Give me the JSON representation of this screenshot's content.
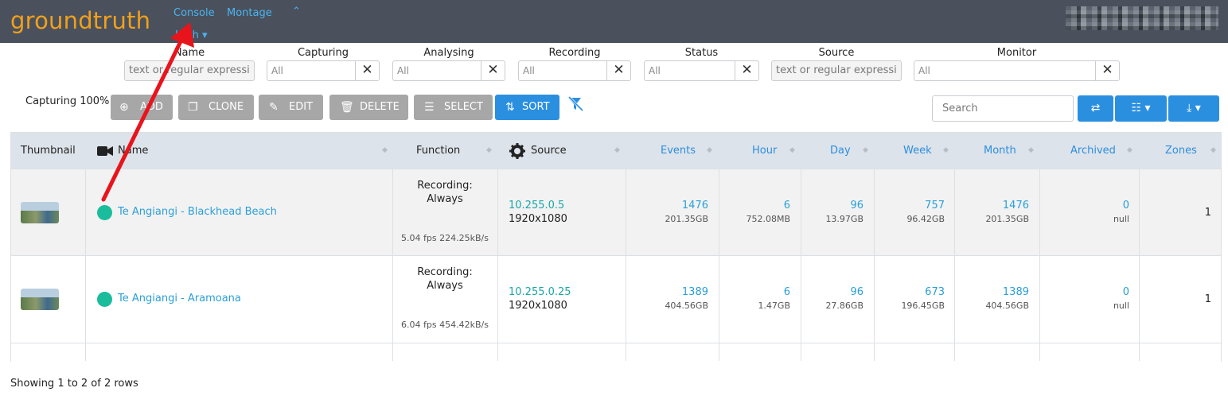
{
  "brand": "groundtruth",
  "nav": {
    "console": "Console",
    "montage": "Montage",
    "caret": "^",
    "bandwidth": "High ▾"
  },
  "filters": {
    "name": {
      "label": "Name",
      "placeholder": "text or regular expressi"
    },
    "capturing": {
      "label": "Capturing",
      "value": "All"
    },
    "analysing": {
      "label": "Analysing",
      "value": "All"
    },
    "recording": {
      "label": "Recording",
      "value": "All"
    },
    "status": {
      "label": "Status",
      "value": "All"
    },
    "source": {
      "label": "Source",
      "placeholder": "text or regular expressi"
    },
    "monitor": {
      "label": "Monitor",
      "value": "All"
    }
  },
  "capturing_pct": "Capturing 100%",
  "toolbar": {
    "add": "ADD",
    "clone": "CLONE",
    "edit": "EDIT",
    "delete": "DELETE",
    "select": "SELECT",
    "sort": "SORT"
  },
  "search_placeholder": "Search",
  "table": {
    "headers": {
      "thumbnail": "Thumbnail",
      "name": "Name",
      "function": "Function",
      "source": "Source",
      "events": "Events",
      "hour": "Hour",
      "day": "Day",
      "week": "Week",
      "month": "Month",
      "archived": "Archived",
      "zones": "Zones"
    },
    "rows": [
      {
        "name": "Te Angiangi - Blackhead Beach",
        "function_line1": "Recording:",
        "function_line2": "Always",
        "fps": "5.04 fps 224.25kB/s",
        "source_ip": "10.255.0.5",
        "source_res": "1920x1080",
        "events": "1476",
        "events_size": "201.35GB",
        "hour": "6",
        "hour_size": "752.08MB",
        "day": "96",
        "day_size": "13.97GB",
        "week": "757",
        "week_size": "96.42GB",
        "month": "1476",
        "month_size": "201.35GB",
        "archived": "0",
        "archived_size": "null",
        "zones": "1"
      },
      {
        "name": "Te Angiangi - Aramoana",
        "function_line1": "Recording:",
        "function_line2": "Always",
        "fps": "6.04 fps 454.42kB/s",
        "source_ip": "10.255.0.25",
        "source_res": "1920x1080",
        "events": "1389",
        "events_size": "404.56GB",
        "hour": "6",
        "hour_size": "1.47GB",
        "day": "96",
        "day_size": "27.86GB",
        "week": "673",
        "week_size": "196.45GB",
        "month": "1389",
        "month_size": "404.56GB",
        "archived": "0",
        "archived_size": "null",
        "zones": "1"
      }
    ]
  },
  "footer": "Showing 1 to 2 of 2 rows",
  "colors": {
    "brand": "#f0a01c",
    "nav_bg": "#4a515c",
    "accent": "#2b8fe0",
    "status_ok": "#1abc9c",
    "annotation": "#e8141c"
  }
}
